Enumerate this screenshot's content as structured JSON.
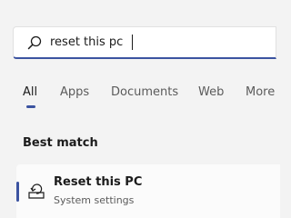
{
  "search": {
    "value": "reset this pc"
  },
  "tabs": [
    {
      "label": "All",
      "active": true
    },
    {
      "label": "Apps"
    },
    {
      "label": "Documents"
    },
    {
      "label": "Web"
    },
    {
      "label": "More"
    }
  ],
  "section": {
    "heading": "Best match"
  },
  "result": {
    "title": "Reset this PC",
    "subtitle": "System settings",
    "icon": "reset-pc-icon"
  },
  "colors": {
    "accent": "#3b53a0"
  }
}
